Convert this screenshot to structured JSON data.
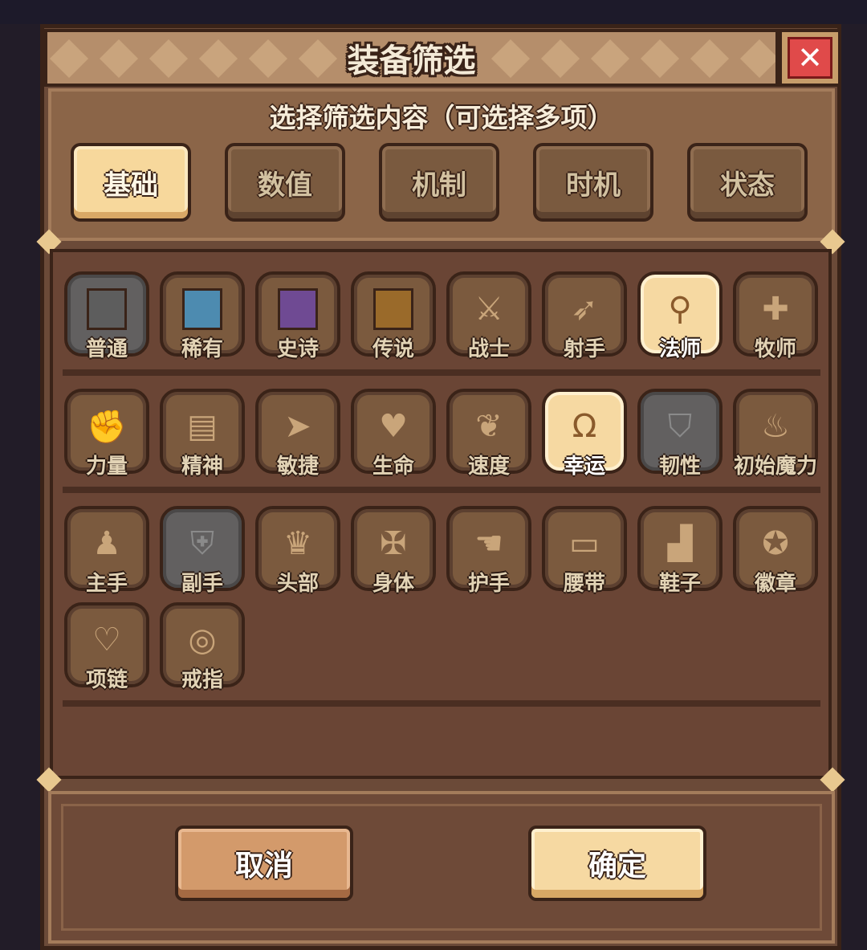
{
  "dialog": {
    "title": "装备筛选",
    "subtitle": "选择筛选内容（可选择多项）",
    "close_label": "✕"
  },
  "tabs": [
    {
      "label": "基础",
      "active": true
    },
    {
      "label": "数值",
      "active": false
    },
    {
      "label": "机制",
      "active": false
    },
    {
      "label": "时机",
      "active": false
    },
    {
      "label": "状态",
      "active": false
    }
  ],
  "rows": {
    "rarity_class": [
      {
        "label": "普通",
        "icon": "swatch-grey-icon",
        "color": "#5d5d5d",
        "style": "grey"
      },
      {
        "label": "稀有",
        "icon": "swatch-blue-icon",
        "color": "#4d8bb0"
      },
      {
        "label": "史诗",
        "icon": "swatch-purple-icon",
        "color": "#6f4a93"
      },
      {
        "label": "传说",
        "icon": "swatch-gold-icon",
        "color": "#9a6a2a"
      },
      {
        "label": "战士",
        "icon": "sword-icon",
        "glyph": "⚔"
      },
      {
        "label": "射手",
        "icon": "crossbow-icon",
        "glyph": "➶"
      },
      {
        "label": "法师",
        "icon": "staff-icon",
        "glyph": "⚲",
        "selected": true
      },
      {
        "label": "牧师",
        "icon": "holy-cross-icon",
        "glyph": "✚"
      }
    ],
    "attributes": [
      {
        "label": "力量",
        "icon": "fist-icon",
        "glyph": "✊"
      },
      {
        "label": "精神",
        "icon": "book-icon",
        "glyph": "▤"
      },
      {
        "label": "敏捷",
        "icon": "boot-icon",
        "glyph": "➤"
      },
      {
        "label": "生命",
        "icon": "heart-icon",
        "glyph": "♥"
      },
      {
        "label": "速度",
        "icon": "wing-icon",
        "glyph": "❦"
      },
      {
        "label": "幸运",
        "icon": "horseshoe-icon",
        "glyph": "Ω",
        "selected": true
      },
      {
        "label": "韧性",
        "icon": "shield-icon",
        "glyph": "⛉",
        "style": "grey"
      },
      {
        "label": "初始魔力",
        "icon": "flame-icon",
        "glyph": "♨"
      }
    ],
    "slots": [
      {
        "label": "主手",
        "icon": "main-hand-icon",
        "glyph": "♟"
      },
      {
        "label": "副手",
        "icon": "off-hand-shield-icon",
        "glyph": "⛨",
        "style": "grey"
      },
      {
        "label": "头部",
        "icon": "helmet-icon",
        "glyph": "♛"
      },
      {
        "label": "身体",
        "icon": "armor-icon",
        "glyph": "✠"
      },
      {
        "label": "护手",
        "icon": "gauntlet-icon",
        "glyph": "☚"
      },
      {
        "label": "腰带",
        "icon": "belt-icon",
        "glyph": "▭"
      },
      {
        "label": "鞋子",
        "icon": "boots-icon",
        "glyph": "▟"
      },
      {
        "label": "徽章",
        "icon": "badge-icon",
        "glyph": "✪"
      }
    ],
    "slots2": [
      {
        "label": "项链",
        "icon": "necklace-icon",
        "glyph": "♡"
      },
      {
        "label": "戒指",
        "icon": "ring-icon",
        "glyph": "◎"
      }
    ]
  },
  "buttons": {
    "cancel": "取消",
    "confirm": "确定"
  }
}
